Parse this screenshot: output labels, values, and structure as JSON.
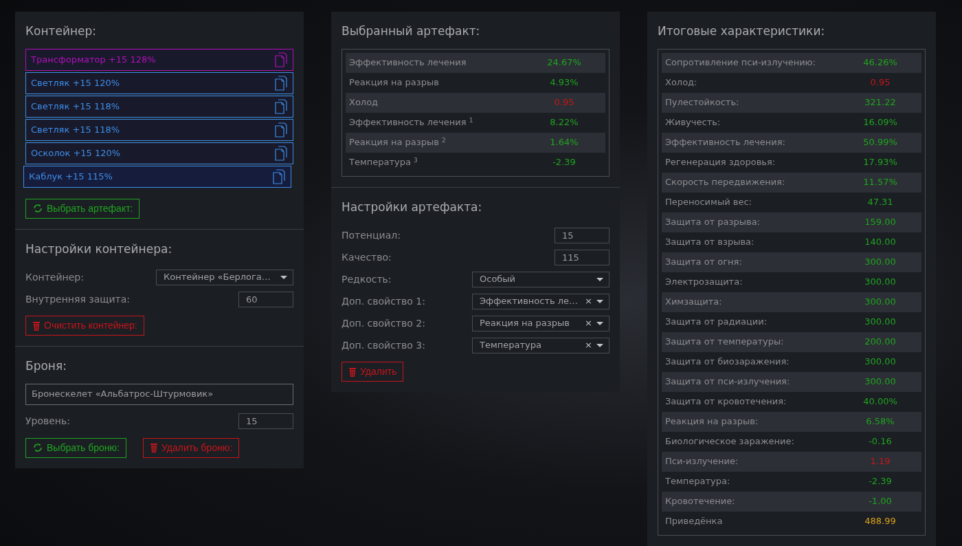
{
  "container_panel": {
    "title": "Контейнер:",
    "artifacts": [
      {
        "label": "Трансформатор +15 128%",
        "color": "#b010b8",
        "selected": false
      },
      {
        "label": "Светляк +15 120%",
        "color": "#3d8ee8",
        "selected": false
      },
      {
        "label": "Светляк +15 118%",
        "color": "#3d8ee8",
        "selected": false
      },
      {
        "label": "Светляк +15 118%",
        "color": "#3d8ee8",
        "selected": false
      },
      {
        "label": "Осколок +15 120%",
        "color": "#3d8ee8",
        "selected": false
      },
      {
        "label": "Каблук +15 115%",
        "color": "#3d8ee8",
        "selected": true
      }
    ],
    "choose_button": "Выбрать артефакт:"
  },
  "container_settings": {
    "title": "Настройки контейнера:",
    "fields": [
      {
        "kind": "select",
        "label": "Контейнер:",
        "value": "Контейнер «Берлога…"
      },
      {
        "kind": "input",
        "label": "Внутренняя защита:",
        "value": "60"
      }
    ],
    "clear_button": "Очистить контейнер:"
  },
  "armor": {
    "title": "Броня:",
    "name": "Бронескелет «Альбатрос-Штурмовик»",
    "level_label": "Уровень:",
    "level_value": "15",
    "choose_button": "Выбрать броню:",
    "delete_button": "Удалить броню:"
  },
  "selected_artifact": {
    "title": "Выбранный артефакт:",
    "stats": [
      {
        "name": "Эффективность лечения",
        "value": "24.67%",
        "color": "#1fa51f"
      },
      {
        "name": "Реакция на разрыв",
        "value": "4.93%",
        "color": "#1fa51f"
      },
      {
        "name": "Холод",
        "value": "0.95",
        "color": "#c4161c"
      },
      {
        "name": "Эффективность лечения $^{1}$",
        "value": "8.22%",
        "color": "#1fa51f"
      },
      {
        "name": "Реакция на разрыв $^{2}$",
        "value": "1.64%",
        "color": "#1fa51f"
      },
      {
        "name": "Температура $^{3}$",
        "value": "-2.39",
        "color": "#1fa51f"
      }
    ]
  },
  "artifact_settings": {
    "title": "Настройки артефакта:",
    "fields": [
      {
        "kind": "input",
        "label": "Потенциал:",
        "value": "15"
      },
      {
        "kind": "input",
        "label": "Качество:",
        "value": "115"
      },
      {
        "kind": "select",
        "label": "Редкость:",
        "value": "Особый"
      },
      {
        "kind": "select_clear",
        "label": "Доп. свойство 1:",
        "value": "Эффективность ле…",
        "clear": "×"
      },
      {
        "kind": "select_clear",
        "label": "Доп. свойство 2:",
        "value": "Реакция на разрыв",
        "clear": "×"
      },
      {
        "kind": "select_clear",
        "label": "Доп. свойство 3:",
        "value": "Температура",
        "clear": "×"
      }
    ],
    "delete_button": "Удалить"
  },
  "totals": {
    "title": "Итоговые характеристики:",
    "stats": [
      {
        "name": "Сопротивление пси-излучению:",
        "value": "46.26%",
        "color": "#1fa51f"
      },
      {
        "name": "Холод:",
        "value": "0.95",
        "color": "#c4161c"
      },
      {
        "name": "Пулестойкость:",
        "value": "321.22",
        "color": "#1fa51f"
      },
      {
        "name": "Живучесть:",
        "value": "16.09%",
        "color": "#1fa51f"
      },
      {
        "name": "Эффективность лечения:",
        "value": "50.99%",
        "color": "#1fa51f"
      },
      {
        "name": "Регенерация здоровья:",
        "value": "17.93%",
        "color": "#1fa51f"
      },
      {
        "name": "Скорость передвижения:",
        "value": "11.57%",
        "color": "#1fa51f"
      },
      {
        "name": "Переносимый вес:",
        "value": "47.31",
        "color": "#1fa51f"
      },
      {
        "name": "Защита от разрыва:",
        "value": "159.00",
        "color": "#1fa51f"
      },
      {
        "name": "Защита от взрыва:",
        "value": "140.00",
        "color": "#1fa51f"
      },
      {
        "name": "Защита от огня:",
        "value": "300.00",
        "color": "#1fa51f"
      },
      {
        "name": "Электрозащита:",
        "value": "300.00",
        "color": "#1fa51f"
      },
      {
        "name": "Химзащита:",
        "value": "300.00",
        "color": "#1fa51f"
      },
      {
        "name": "Защита от радиации:",
        "value": "300.00",
        "color": "#1fa51f"
      },
      {
        "name": "Защита от температуры:",
        "value": "200.00",
        "color": "#1fa51f"
      },
      {
        "name": "Защита от биозаражения:",
        "value": "300.00",
        "color": "#1fa51f"
      },
      {
        "name": "Защита от пси-излучения:",
        "value": "300.00",
        "color": "#1fa51f"
      },
      {
        "name": "Защита от кровотечения:",
        "value": "40.00%",
        "color": "#1fa51f"
      },
      {
        "name": "Реакция на разрыв:",
        "value": "6.58%",
        "color": "#1fa51f"
      },
      {
        "name": "Биологическое заражение:",
        "value": "-0.16",
        "color": "#1fa51f"
      },
      {
        "name": "Пси-излучение:",
        "value": "1.19",
        "color": "#c4161c"
      },
      {
        "name": "Температура:",
        "value": "-2.39",
        "color": "#1fa51f"
      },
      {
        "name": "Кровотечение:",
        "value": "-1.00",
        "color": "#1fa51f"
      },
      {
        "name": "Приведёнка",
        "value": "488.99",
        "color": "#d9a21b"
      }
    ]
  }
}
